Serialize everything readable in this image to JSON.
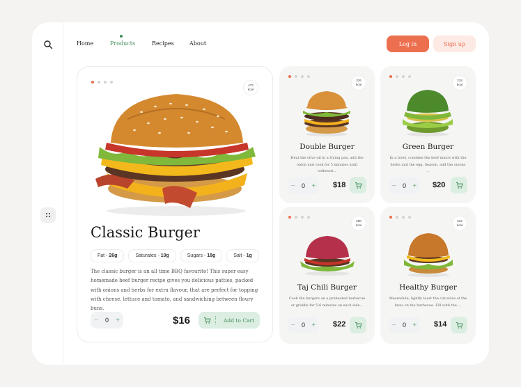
{
  "nav": {
    "items": [
      "Home",
      "Products",
      "Recipes",
      "About"
    ],
    "active": "Products",
    "login": "Log in",
    "signup": "Sign up"
  },
  "hero": {
    "kcal_value": "472",
    "kcal_unit": "kcal",
    "title": "Classic Burger",
    "nutrients": [
      {
        "label": "Fat - ",
        "value": "26g"
      },
      {
        "label": "Saturates - ",
        "value": "10g"
      },
      {
        "label": "Sugars - ",
        "value": "18g"
      },
      {
        "label": "Salt - ",
        "value": "1g"
      }
    ],
    "description": "The classic burger is an all time BBQ favourite! This super easy homemade beef burger recipe gives you delicious patties, packed with onions and herbs for extra flavour, that are perfect for topping with cheese, lettuce and tomato, and sandwiching between floury buns.",
    "qty": "0",
    "minus": "−",
    "plus": "+",
    "price": "$16",
    "add_to_cart": "Add to Cart"
  },
  "cards": [
    {
      "kcal_value": "326",
      "kcal_unit": "kcal",
      "title": "Double Burger",
      "desc": "Heat the olive oil in a frying pan, add the onion and cook for 5 minutes until softened...",
      "qty": "0",
      "minus": "−",
      "plus": "+",
      "price": "$18"
    },
    {
      "kcal_value": "218",
      "kcal_unit": "kcal",
      "title": "Green Burger",
      "desc": "In a bowl, combine the beef mince with the herbs and the egg. Season, add the onions ...",
      "qty": "0",
      "minus": "−",
      "plus": "+",
      "price": "$20"
    },
    {
      "kcal_value": "280",
      "kcal_unit": "kcal",
      "title": "Taj Chili Burger",
      "desc": "Cook the burgers on a preheated barbecue or griddle for 5-6 minutes on each side...",
      "qty": "0",
      "minus": "−",
      "plus": "+",
      "price": "$22"
    },
    {
      "kcal_value": "312",
      "kcal_unit": "kcal",
      "title": "Healthy Burger",
      "desc": "Meanwhile, lightly toast the cut-sides of the buns on the barbecue. Fill with the ...",
      "qty": "0",
      "minus": "−",
      "plus": "+",
      "price": "$14"
    }
  ],
  "colors": {
    "accent": "#ec6f4f",
    "green": "#3f8a57",
    "green_light": "#dceee2"
  }
}
